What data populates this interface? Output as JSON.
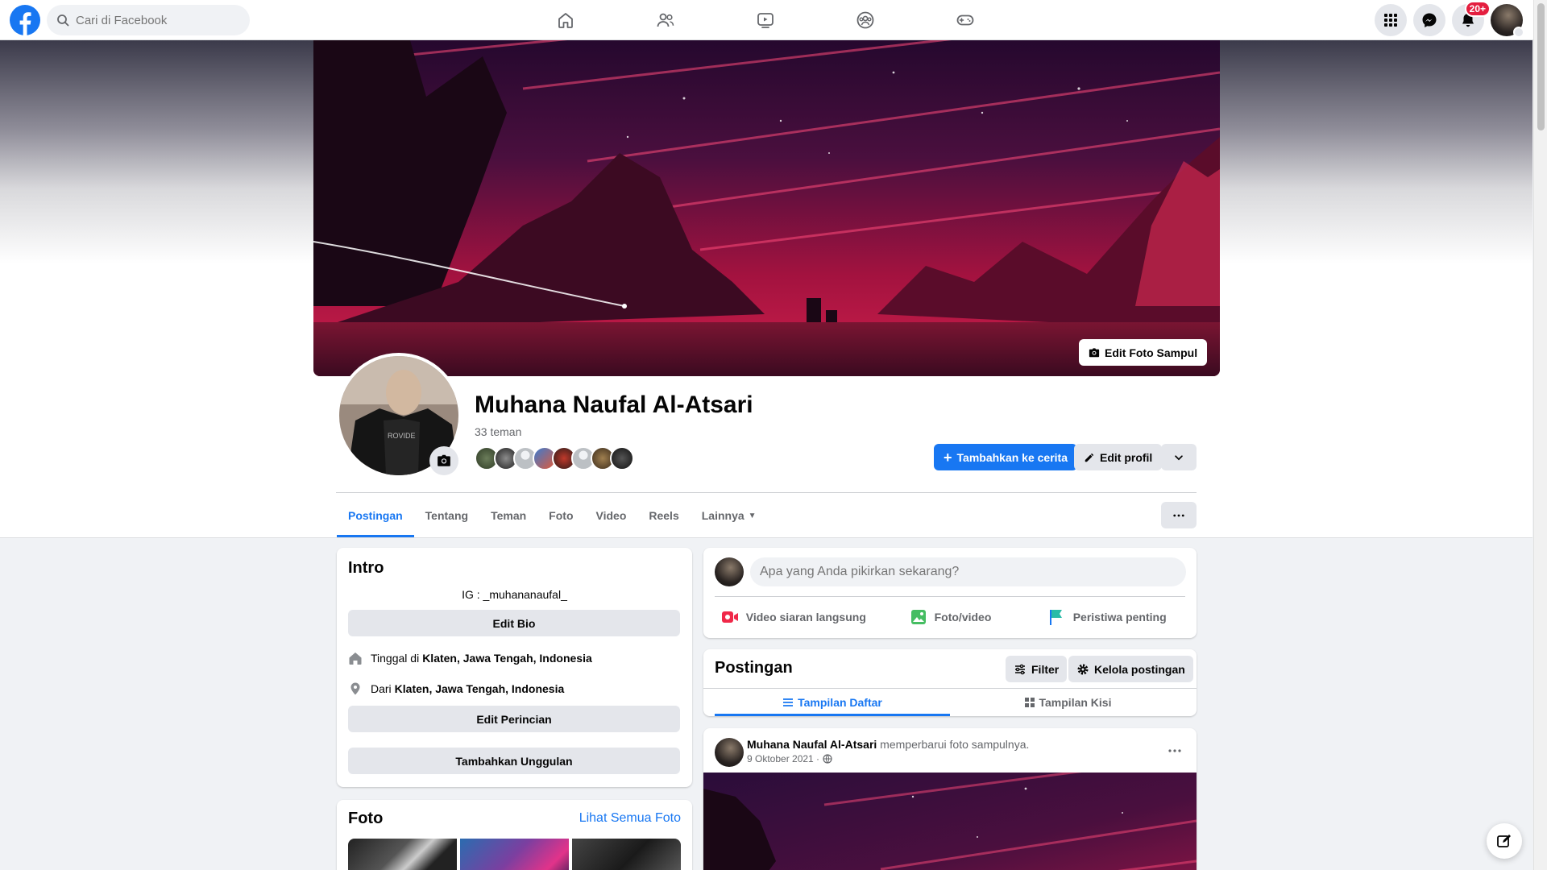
{
  "colors": {
    "accent": "#1877f2",
    "badge": "#e41e3f",
    "text_secondary": "#65676b",
    "cover_pink": "#b3144a",
    "cover_purple": "#2a0e3a"
  },
  "topbar": {
    "search_placeholder": "Cari di Facebook",
    "nav_icons": [
      "home-icon",
      "friends-icon",
      "watch-icon",
      "groups-icon",
      "gaming-icon"
    ],
    "notifications_badge": "20+"
  },
  "cover": {
    "edit_label": "Edit Foto Sampul"
  },
  "profile": {
    "name": "Muhana Naufal Al-Atsari",
    "friends": "33 teman",
    "add_story_label": "Tambahkan ke cerita",
    "edit_profile_label": "Edit profil"
  },
  "tabs": [
    {
      "label": "Postingan",
      "active": true
    },
    {
      "label": "Tentang"
    },
    {
      "label": "Teman"
    },
    {
      "label": "Foto"
    },
    {
      "label": "Video"
    },
    {
      "label": "Reels"
    },
    {
      "label": "Lainnya"
    }
  ],
  "intro": {
    "title": "Intro",
    "bio": "IG : _muhananaufal_",
    "edit_bio": "Edit Bio",
    "lives_prefix": "Tinggal di",
    "lives_place": "Klaten, Jawa Tengah, Indonesia",
    "from_prefix": "Dari",
    "from_place": "Klaten, Jawa Tengah, Indonesia",
    "edit_details": "Edit Perincian",
    "add_featured": "Tambahkan Unggulan"
  },
  "photos": {
    "title": "Foto",
    "see_all": "Lihat Semua Foto"
  },
  "composer": {
    "placeholder": "Apa yang Anda pikirkan sekarang?",
    "live": "Video siaran langsung",
    "photo": "Foto/video",
    "event": "Peristiwa penting"
  },
  "posts": {
    "title": "Postingan",
    "filter": "Filter",
    "manage": "Kelola postingan",
    "list_view": "Tampilan Daftar",
    "grid_view": "Tampilan Kisi"
  },
  "post": {
    "author": "Muhana Naufal Al-Atsari",
    "action": "memperbarui foto sampulnya.",
    "date": "9 Oktober 2021 ·"
  }
}
